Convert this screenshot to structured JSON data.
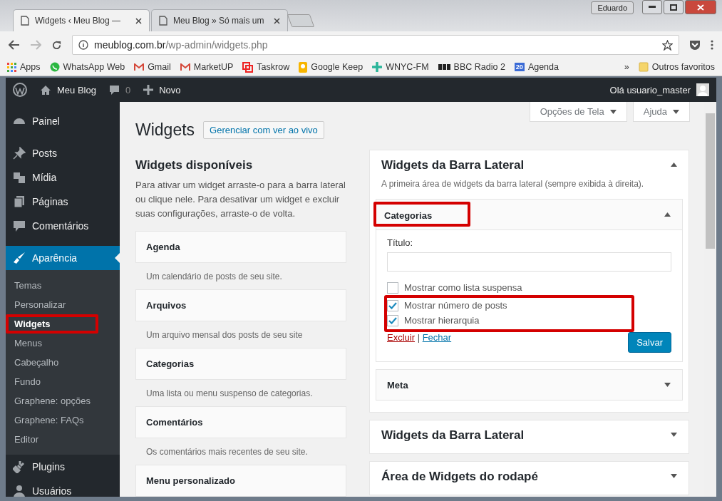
{
  "browser": {
    "profile": "Eduardo",
    "tabs": [
      {
        "title": "Widgets ‹ Meu Blog —",
        "selected": true
      },
      {
        "title": "Meu Blog » Só mais um",
        "selected": false
      }
    ],
    "url_host": "meublog.com.br",
    "url_path": "/wp-admin/widgets.php",
    "bookmarks": [
      {
        "label": "Apps"
      },
      {
        "label": "WhatsApp Web"
      },
      {
        "label": "Gmail"
      },
      {
        "label": "MarketUP"
      },
      {
        "label": "Taskrow"
      },
      {
        "label": "Google Keep"
      },
      {
        "label": "WNYC-FM"
      },
      {
        "label": "BBC Radio 2"
      },
      {
        "label": "Agenda",
        "badge": "20"
      }
    ],
    "overflow": "»",
    "other_bookmarks": "Outros favoritos"
  },
  "admin_bar": {
    "site": "Meu Blog",
    "comments": "0",
    "new": "Novo",
    "greeting": "Olá usuario_master"
  },
  "sidebar": {
    "groups": [
      [
        {
          "label": "Painel",
          "selected": false
        }
      ],
      [
        {
          "label": "Posts",
          "selected": false
        },
        {
          "label": "Mídia",
          "selected": false
        },
        {
          "label": "Páginas",
          "selected": false
        },
        {
          "label": "Comentários",
          "selected": false
        }
      ],
      [
        {
          "label": "Aparência",
          "selected": true,
          "children": [
            {
              "label": "Temas",
              "selected": false,
              "highlighted": false
            },
            {
              "label": "Personalizar",
              "selected": false,
              "highlighted": false
            },
            {
              "label": "Widgets",
              "selected": true,
              "highlighted": true
            },
            {
              "label": "Menus",
              "selected": false,
              "highlighted": false
            },
            {
              "label": "Cabeçalho",
              "selected": false,
              "highlighted": false
            },
            {
              "label": "Fundo",
              "selected": false,
              "highlighted": false
            },
            {
              "label": "Graphene: opções",
              "selected": false,
              "highlighted": false
            },
            {
              "label": "Graphene: FAQs",
              "selected": false,
              "highlighted": false
            },
            {
              "label": "Editor",
              "selected": false,
              "highlighted": false
            }
          ]
        },
        {
          "label": "Plugins",
          "selected": false
        },
        {
          "label": "Usuários",
          "selected": false
        }
      ]
    ]
  },
  "screen_buttons": [
    "Opções de Tela",
    "Ajuda"
  ],
  "page": {
    "title": "Widgets",
    "action": "Gerenciar com ver ao vivo"
  },
  "available": {
    "heading": "Widgets disponíveis",
    "intro": "Para ativar um widget arraste-o para a barra lateral ou clique nele. Para desativar um widget e excluir suas configurações, arraste-o de volta.",
    "widgets": [
      {
        "name": "Agenda",
        "description": "Um calendário de posts de seu site."
      },
      {
        "name": "Arquivos",
        "description": "Um arquivo mensal dos posts de seu site"
      },
      {
        "name": "Categorias",
        "description": "Uma lista ou menu suspenso de categorias."
      },
      {
        "name": "Comentários",
        "description": "Os comentários mais recentes de seu site."
      },
      {
        "name": "Menu personalizado"
      }
    ]
  },
  "areas": [
    {
      "title": "Widgets da Barra Lateral",
      "expanded": true,
      "description": "A primeira área de widgets da barra lateral (sempre exibida à direita).",
      "widgets": [
        {
          "name": "Categorias",
          "expanded": true,
          "highlighted": true,
          "title_label": "Título:",
          "options": [
            {
              "label": "Mostrar como lista suspensa",
              "checked": false,
              "highlighted": false
            },
            {
              "label": "Mostrar número de posts",
              "checked": true,
              "highlighted": true
            },
            {
              "label": "Mostrar hierarquia",
              "checked": true,
              "highlighted": true
            }
          ],
          "delete": "Excluir",
          "separator": "|",
          "close": "Fechar",
          "save": "Salvar"
        },
        {
          "name": "Meta",
          "expanded": false,
          "highlighted": false
        }
      ]
    },
    {
      "title": "Widgets da Barra Lateral",
      "expanded": false
    },
    {
      "title": "Área de Widgets do rodapé",
      "expanded": false
    }
  ]
}
